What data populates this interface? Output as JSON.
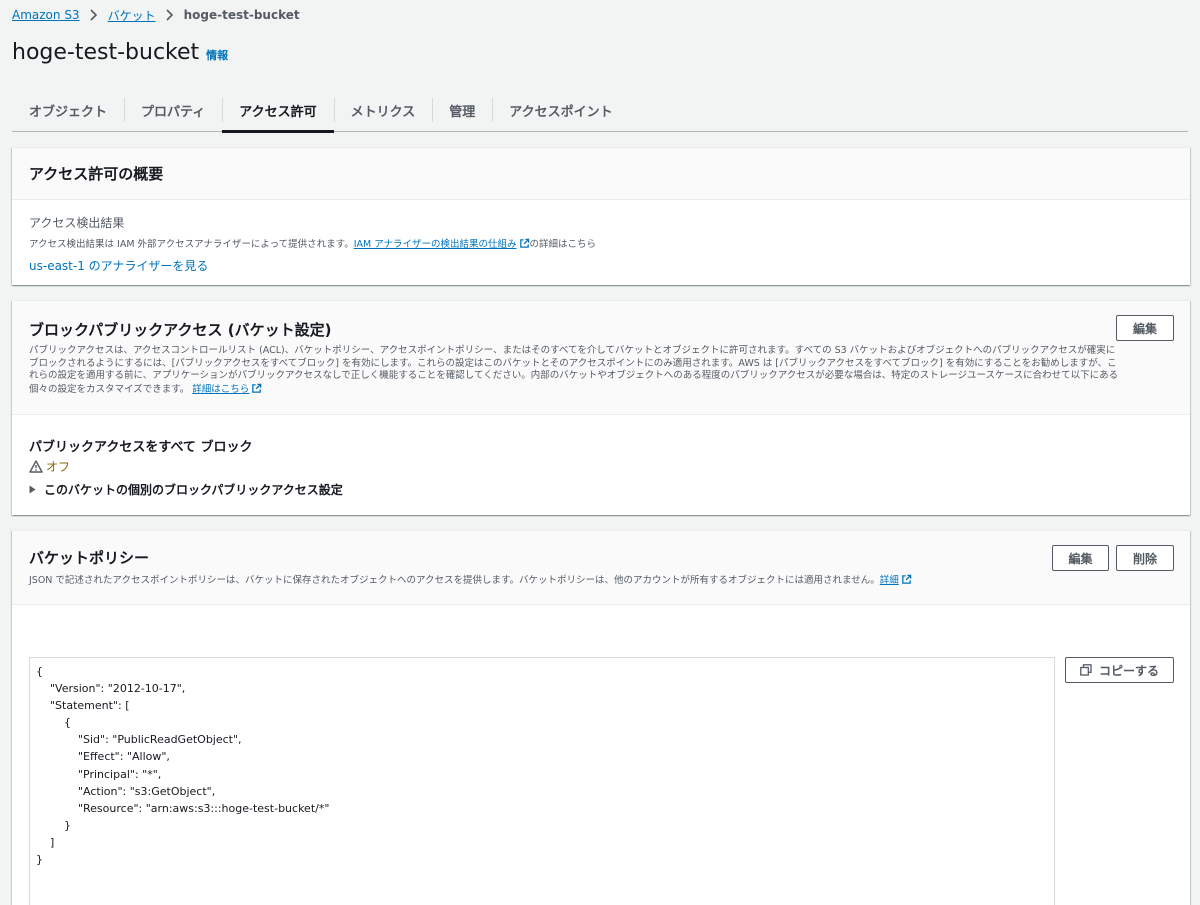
{
  "breadcrumb": {
    "items": [
      "Amazon S3",
      "バケット"
    ],
    "current": "hoge-test-bucket"
  },
  "header": {
    "title": "hoge-test-bucket",
    "info": "情報"
  },
  "tabs": [
    "オブジェクト",
    "プロパティ",
    "アクセス許可",
    "メトリクス",
    "管理",
    "アクセスポイント"
  ],
  "active_tab": "アクセス許可",
  "summary": {
    "title": "アクセス許可の概要",
    "findings_label": "アクセス検出結果",
    "findings_desc_prefix": "アクセス検出結果は IAM 外部アクセスアナライザーによって提供されます。",
    "findings_desc_link": "IAM アナライザーの検出結果の仕組み",
    "findings_desc_suffix": "の詳細はこちら",
    "analyzer_link": "us-east-1 のアナライザーを見る"
  },
  "block_public_access": {
    "title": "ブロックパブリックアクセス (バケット設定)",
    "edit_label": "編集",
    "description": "パブリックアクセスは、アクセスコントロールリスト (ACL)、バケットポリシー、アクセスポイントポリシー、またはそのすべてを介してバケットとオブジェクトに許可されます。すべての S3 バケットおよびオブジェクトへのパブリックアクセスが確実にブロックされるようにするには、[パブリックアクセスをすべてブロック] を有効にします。これらの設定はこのバケットとそのアクセスポイントにのみ適用されます。AWS は [パブリックアクセスをすべてブロック] を有効にすることをお勧めしますが、これらの設定を適用する前に、アプリケーションがパブリックアクセスなしで正しく機能することを確認してください。内部のバケットやオブジェクトへのある程度のパブリックアクセスが必要な場合は、特定のストレージユースケースに合わせて以下にある個々の設定をカスタマイズできます。",
    "learn_more": "詳細はこちら",
    "setting_label": "パブリックアクセスをすべて ブロック",
    "status": "オフ",
    "expand_label": "このバケットの個別のブロックパブリックアクセス設定"
  },
  "bucket_policy": {
    "title": "バケットポリシー",
    "edit_label": "編集",
    "delete_label": "削除",
    "description": "JSON で記述されたアクセスポイントポリシーは、バケットに保存されたオブジェクトへのアクセスを提供します。バケットポリシーは、他のアカウントが所有するオブジェクトには適用されません。",
    "learn_more": "詳細",
    "copy_label": "コピーする",
    "policy_text": "{\n    \"Version\": \"2012-10-17\",\n    \"Statement\": [\n        {\n            \"Sid\": \"PublicReadGetObject\",\n            \"Effect\": \"Allow\",\n            \"Principal\": \"*\",\n            \"Action\": \"s3:GetObject\",\n            \"Resource\": \"arn:aws:s3:::hoge-test-bucket/*\"\n        }\n    ]\n}"
  },
  "colors": {
    "link": "#0073bb",
    "warning": "#8d6605",
    "text": "#16191f",
    "secondary_text": "#545b64",
    "background": "#f2f3f3"
  }
}
